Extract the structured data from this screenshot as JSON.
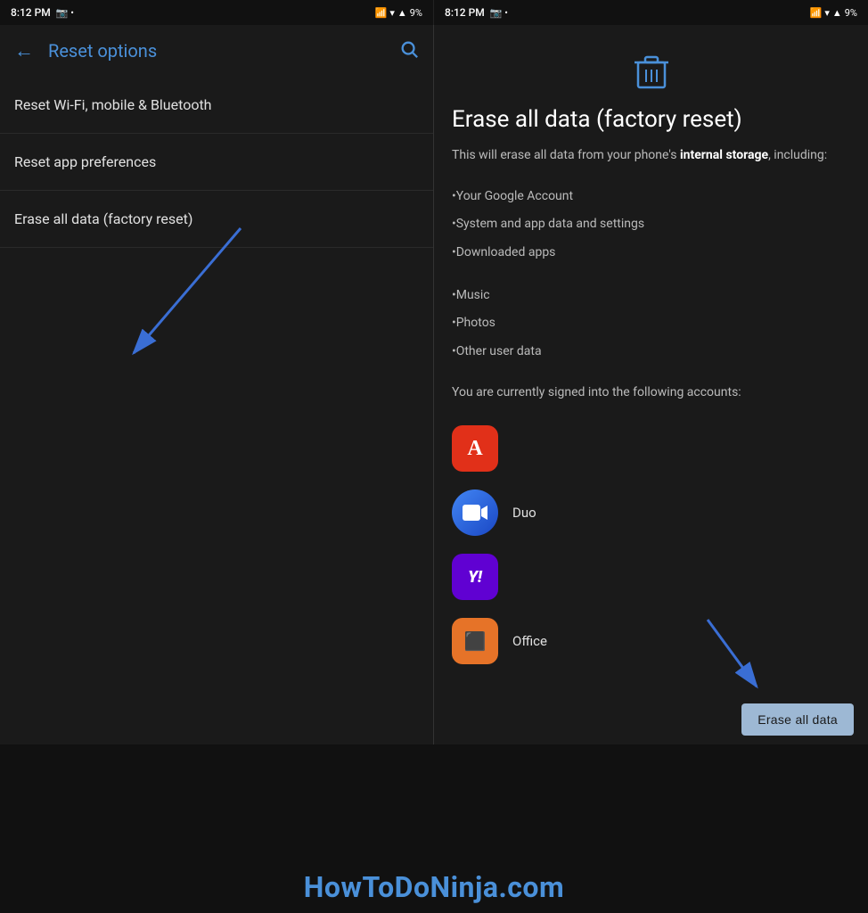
{
  "left_status": {
    "time": "8:12 PM",
    "battery": "9%"
  },
  "right_status": {
    "time": "8:12 PM",
    "battery": "9%"
  },
  "left_panel": {
    "title": "Reset options",
    "back_label": "←",
    "search_label": "🔍",
    "menu_items": [
      {
        "id": "wifi",
        "label": "Reset Wi-Fi, mobile & Bluetooth"
      },
      {
        "id": "app-prefs",
        "label": "Reset app preferences"
      },
      {
        "id": "factory",
        "label": "Erase all data (factory reset)"
      }
    ]
  },
  "right_panel": {
    "title": "Erase all data (factory reset)",
    "subtitle_normal": "This will erase all data from your phone's ",
    "subtitle_bold": "internal storage",
    "subtitle_end": ", including:",
    "bullets": [
      "•Your Google Account",
      "•System and app data and settings",
      "•Downloaded apps",
      "•Music",
      "•Photos",
      "•Other user data"
    ],
    "accounts_label": "You are currently signed into the following accounts:",
    "apps": [
      {
        "id": "adobe",
        "name": ""
      },
      {
        "id": "duo",
        "name": "Duo"
      },
      {
        "id": "yahoo",
        "name": ""
      },
      {
        "id": "office",
        "name": "Office"
      }
    ],
    "erase_button_label": "Erase all data"
  },
  "watermark": "HowToDoNinja.com"
}
